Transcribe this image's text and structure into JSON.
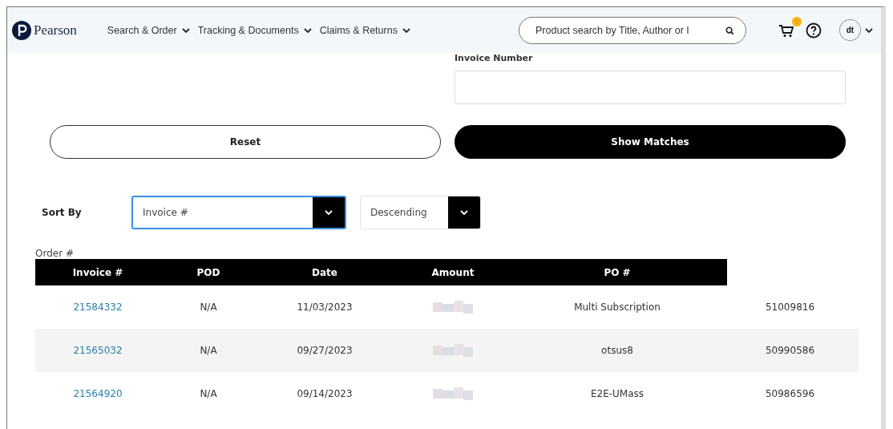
{
  "header": {
    "logo": "Pearson",
    "nav": [
      {
        "label": "Search & Order"
      },
      {
        "label": "Tracking & Documents"
      },
      {
        "label": "Claims & Returns"
      }
    ],
    "search": {
      "placeholder": "Product search by Title, Author or I"
    },
    "cart_count": "0",
    "avatar": "dt"
  },
  "filters": {
    "invoice_number": {
      "label": "Invoice Number"
    },
    "buttons": [
      {
        "label": "Reset",
        "kind": "outline"
      },
      {
        "label": "Show Matches",
        "kind": "primary"
      }
    ]
  },
  "sort": {
    "label": "Sort By",
    "selects": [
      {
        "value": "Invoice #",
        "focused": true
      },
      {
        "value": "Descending",
        "focused": false
      }
    ]
  },
  "table": {
    "order_label": "Order #",
    "columns": [
      "Invoice #",
      "POD",
      "Date",
      "Amount",
      "PO #"
    ],
    "rows": [
      {
        "invoice": "21584332",
        "pod": "N/A",
        "date": "11/03/2023",
        "amount_hidden": true,
        "po": "Multi Subscription",
        "order": "51009816"
      },
      {
        "invoice": "21565032",
        "pod": "N/A",
        "date": "09/27/2023",
        "amount_hidden": true,
        "po": "otsus8",
        "order": "50990586"
      },
      {
        "invoice": "21564920",
        "pod": "N/A",
        "date": "09/14/2023",
        "amount_hidden": true,
        "po": "E2E-UMass",
        "order": "50986596"
      }
    ]
  }
}
